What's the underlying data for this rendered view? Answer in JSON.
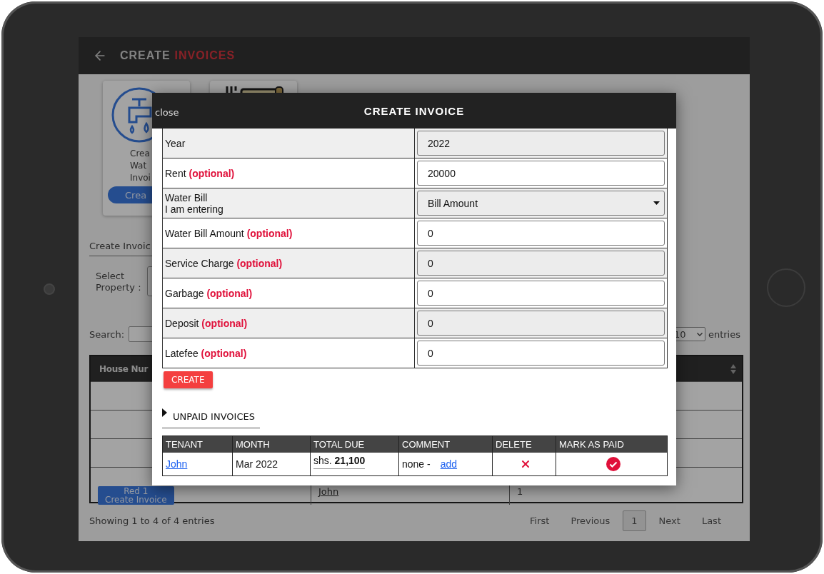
{
  "app_bar": {
    "title_first": "CREATE",
    "title_second": "INVOICES"
  },
  "cards": [
    {
      "kind": "water",
      "lines": [
        "Crea",
        "Wat",
        "Invoi"
      ],
      "button": "Crea"
    },
    {
      "kind": "receipt"
    }
  ],
  "section_tab": "Create Invoic",
  "select_property_label": "Select Property :",
  "search_label": "Search:",
  "entries": {
    "value": "10",
    "label": "entries"
  },
  "table": {
    "columns": [
      "House Nur"
    ],
    "rows": [
      {
        "kind": "empty"
      },
      {
        "kind": "empty"
      },
      {
        "kind": "empty"
      },
      {
        "kind": "action",
        "button_lines": [
          "Red 1",
          "Create Invoice"
        ],
        "tenant": "John",
        "count": "1"
      }
    ]
  },
  "footer": {
    "showing": "Showing 1 to 4 of 4 entries",
    "pages": [
      {
        "label": "First",
        "selected": false
      },
      {
        "label": "Previous",
        "selected": false
      },
      {
        "label": "1",
        "selected": true
      },
      {
        "label": "Next",
        "selected": false
      },
      {
        "label": "Last",
        "selected": false
      }
    ]
  },
  "modal": {
    "close": "close",
    "title": "CREATE INVOICE",
    "fields": [
      {
        "kind": "input",
        "label": "Year",
        "value": "2022"
      },
      {
        "kind": "input",
        "label": "Rent",
        "note": "(optional)",
        "value": "20000"
      },
      {
        "kind": "select",
        "label_lines": [
          "Water Bill",
          "I am entering"
        ],
        "value": "Bill Amount"
      },
      {
        "kind": "input",
        "label": "Water Bill Amount",
        "note": "(optional)",
        "value": "0"
      },
      {
        "kind": "input",
        "label": "Service Charge",
        "note": "(optional)",
        "value": "0"
      },
      {
        "kind": "input",
        "label": "Garbage",
        "note": "(optional)",
        "value": "0"
      },
      {
        "kind": "input",
        "label": "Deposit",
        "note": "(optional)",
        "value": "0"
      },
      {
        "kind": "input",
        "label": "Latefee",
        "note": "(optional)",
        "value": "0"
      }
    ],
    "create_button": "CREATE",
    "unpaid_title": "UNPAID INVOICES",
    "unpaid_table": {
      "columns": [
        "TENANT",
        "MONTH",
        "TOTAL DUE",
        "COMMENT",
        "DELETE",
        "MARK AS PAID"
      ],
      "rows": [
        {
          "tenant": "John",
          "month": "Mar 2022",
          "total_due": "shs. **21,100**",
          "comment": "none -",
          "comment_link": "add"
        }
      ]
    }
  }
}
